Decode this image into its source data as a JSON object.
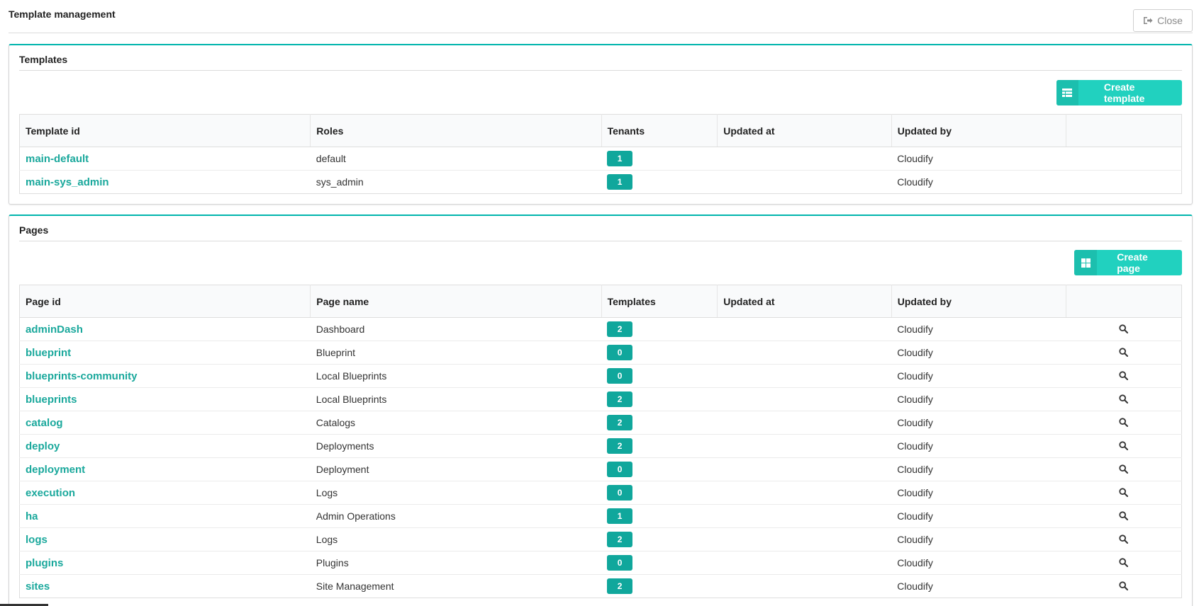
{
  "header": {
    "title": "Template management",
    "close_label": "Close"
  },
  "templates": {
    "title": "Templates",
    "create_label": "Create template",
    "columns": [
      "Template id",
      "Roles",
      "Tenants",
      "Updated at",
      "Updated by",
      ""
    ],
    "rows": [
      {
        "id": "main-default",
        "roles": "default",
        "tenants": "1",
        "updated_at": "",
        "updated_by": "Cloudify"
      },
      {
        "id": "main-sys_admin",
        "roles": "sys_admin",
        "tenants": "1",
        "updated_at": "",
        "updated_by": "Cloudify"
      }
    ]
  },
  "pages": {
    "title": "Pages",
    "create_label": "Create page",
    "columns": [
      "Page id",
      "Page name",
      "Templates",
      "Updated at",
      "Updated by",
      ""
    ],
    "rows": [
      {
        "id": "adminDash",
        "name": "Dashboard",
        "templates": "2",
        "updated_at": "",
        "updated_by": "Cloudify"
      },
      {
        "id": "blueprint",
        "name": "Blueprint",
        "templates": "0",
        "updated_at": "",
        "updated_by": "Cloudify"
      },
      {
        "id": "blueprints-community",
        "name": "Local Blueprints",
        "templates": "0",
        "updated_at": "",
        "updated_by": "Cloudify"
      },
      {
        "id": "blueprints",
        "name": "Local Blueprints",
        "templates": "2",
        "updated_at": "",
        "updated_by": "Cloudify"
      },
      {
        "id": "catalog",
        "name": "Catalogs",
        "templates": "2",
        "updated_at": "",
        "updated_by": "Cloudify"
      },
      {
        "id": "deploy",
        "name": "Deployments",
        "templates": "2",
        "updated_at": "",
        "updated_by": "Cloudify"
      },
      {
        "id": "deployment",
        "name": "Deployment",
        "templates": "0",
        "updated_at": "",
        "updated_by": "Cloudify"
      },
      {
        "id": "execution",
        "name": "Logs",
        "templates": "0",
        "updated_at": "",
        "updated_by": "Cloudify"
      },
      {
        "id": "ha",
        "name": "Admin Operations",
        "templates": "1",
        "updated_at": "",
        "updated_by": "Cloudify"
      },
      {
        "id": "logs",
        "name": "Logs",
        "templates": "2",
        "updated_at": "",
        "updated_by": "Cloudify"
      },
      {
        "id": "plugins",
        "name": "Plugins",
        "templates": "0",
        "updated_at": "",
        "updated_by": "Cloudify"
      },
      {
        "id": "sites",
        "name": "Site Management",
        "templates": "2",
        "updated_at": "",
        "updated_by": "Cloudify"
      }
    ]
  },
  "colors": {
    "accent": "#00b5ad",
    "button": "#21d1bf",
    "badge": "#10a79c",
    "link": "#1aa89c"
  }
}
